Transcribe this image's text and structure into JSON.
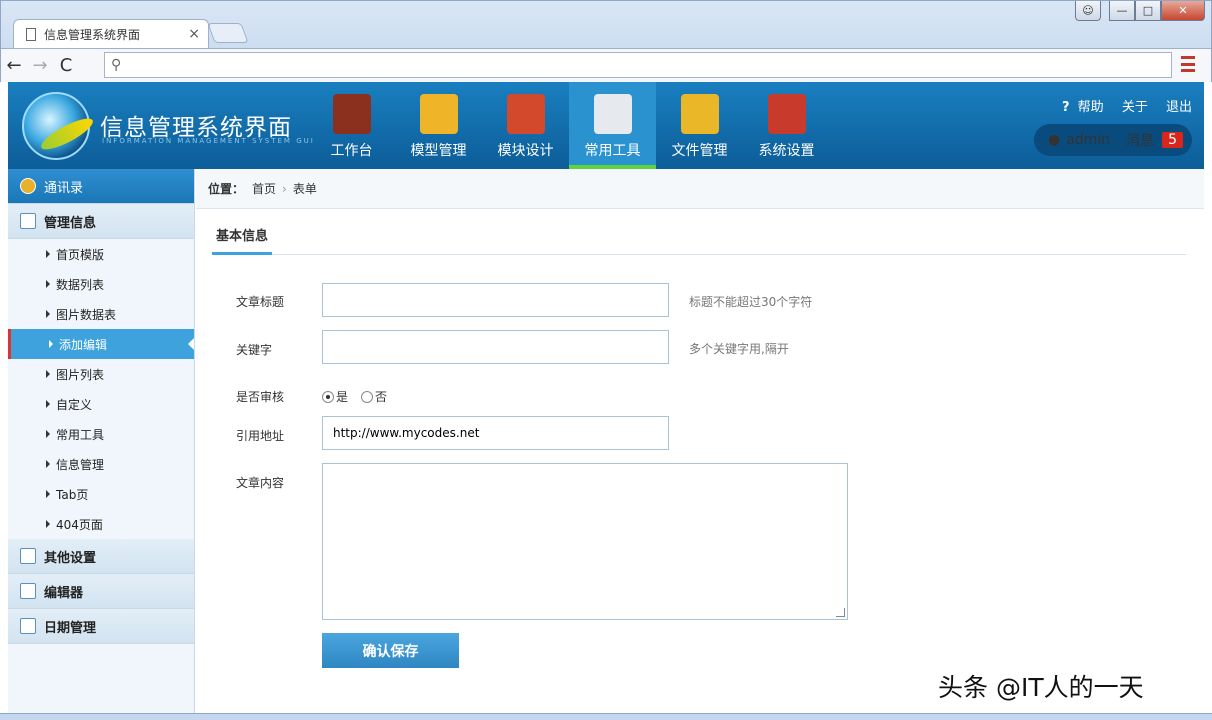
{
  "browser": {
    "tab_title": "信息管理系统界面",
    "tab_close": "×",
    "address": "",
    "back": "←",
    "forward": "→",
    "reload": "C",
    "search_glyph": "⚲"
  },
  "header": {
    "title": "信息管理系统界面",
    "subtitle": "INFORMATION MANAGEMENT SYSTEM GUI",
    "nav": [
      {
        "label": "工作台",
        "color": "#8b2f1e"
      },
      {
        "label": "模型管理",
        "color": "#f0b428"
      },
      {
        "label": "模块设计",
        "color": "#d24a2b"
      },
      {
        "label": "常用工具",
        "color": "#e6e9ee"
      },
      {
        "label": "文件管理",
        "color": "#e9b728"
      },
      {
        "label": "系统设置",
        "color": "#c83a2c"
      }
    ],
    "links": {
      "help": "帮助",
      "about": "关于",
      "logout": "退出"
    },
    "help_icon": "?",
    "username": "admin",
    "messages_label": "消息",
    "messages_count": "5"
  },
  "sidebar": {
    "top": "通讯录",
    "groups": [
      {
        "label": "管理信息"
      },
      {
        "label": "其他设置"
      },
      {
        "label": "编辑器"
      },
      {
        "label": "日期管理"
      }
    ],
    "items": [
      "首页模版",
      "数据列表",
      "图片数据表",
      "添加编辑",
      "图片列表",
      "自定义",
      "常用工具",
      "信息管理",
      "Tab页",
      "404页面"
    ],
    "active_index": 3
  },
  "breadcrumb": {
    "label": "位置：",
    "items": [
      "首页",
      "表单"
    ],
    "sep": "›"
  },
  "form": {
    "tab": "基本信息",
    "title_label": "文章标题",
    "title_value": "",
    "title_hint": "标题不能超过30个字符",
    "keyword_label": "关键字",
    "keyword_value": "",
    "keyword_hint": "多个关键字用,隔开",
    "audit_label": "是否审核",
    "audit_yes": "是",
    "audit_no": "否",
    "url_label": "引用地址",
    "url_value": "http://www.mycodes.net",
    "content_label": "文章内容",
    "content_value": "",
    "save": "确认保存"
  },
  "watermark": "头条 @IT人的一天",
  "colors": {
    "accent": "#3ea3dd",
    "header": "#1a7fc0",
    "badge": "#d9261c"
  }
}
